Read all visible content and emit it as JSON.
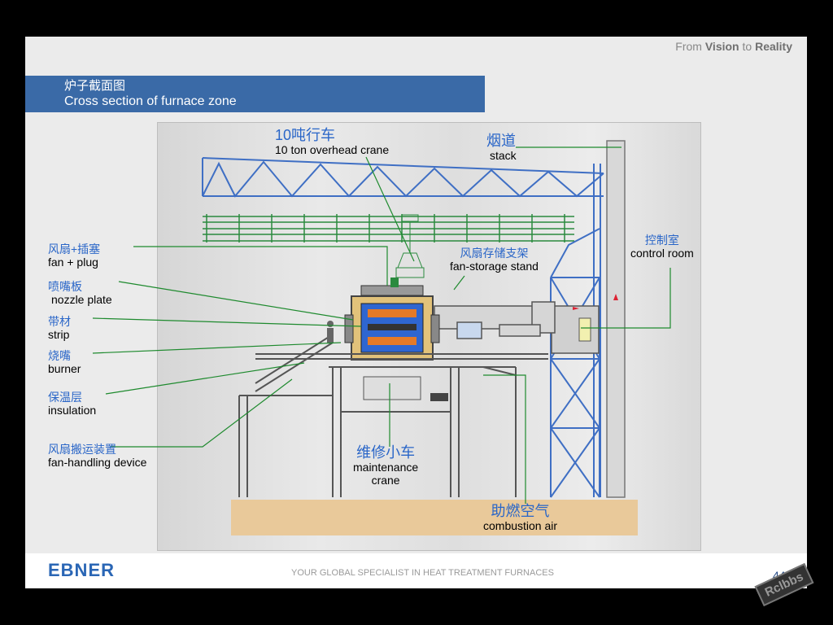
{
  "header": {
    "tagline_prefix": "From",
    "tagline_word1": "Vision",
    "tagline_mid": "to",
    "tagline_word2": "Reality"
  },
  "title": {
    "zh": "炉子截面图",
    "en": "Cross section of furnace zone"
  },
  "labels": {
    "crane_zh": "10吨行车",
    "crane_en": "10 ton overhead crane",
    "stack_zh": "烟道",
    "stack_en": "stack",
    "control_zh": "控制室",
    "control_en": "control room",
    "fan_storage_zh": "风扇存储支架",
    "fan_storage_en": "fan-storage stand",
    "fan_plug_zh": "风扇+插塞",
    "fan_plug_en": "fan + plug",
    "nozzle_zh": "喷嘴板",
    "nozzle_en": "nozzle plate",
    "strip_zh": "带材",
    "strip_en": "strip",
    "burner_zh": "烧嘴",
    "burner_en": "burner",
    "insulation_zh": "保温层",
    "insulation_en": "insulation",
    "fan_handling_zh": "风扇搬运装置",
    "fan_handling_en": "fan-handling device",
    "maintenance_zh": "维修小车",
    "maintenance_en1": "maintenance",
    "maintenance_en2": "crane",
    "combustion_zh": "助燃空气",
    "combustion_en": "combustion air"
  },
  "footer": {
    "logo": "EBNER",
    "text": "YOUR GLOBAL SPECIALIST IN HEAT TREATMENT FURNACES",
    "page": "44"
  },
  "watermark": "Rclbbs",
  "colors": {
    "title_bar": "#3a6aa7",
    "label_zh": "#2a66c8",
    "leader_line": "#1e8a2e",
    "structure_blue": "#3f6fc4",
    "rail_green": "#2a8a3e",
    "ground": "#e9c99a"
  }
}
